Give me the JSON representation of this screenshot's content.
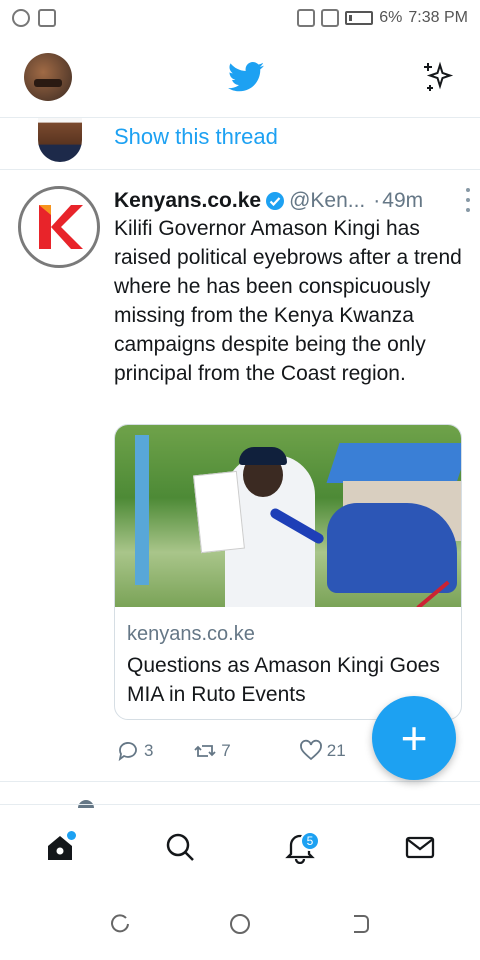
{
  "status_bar": {
    "battery": "6%",
    "time": "7:38 PM"
  },
  "header": {
    "profile_icon": "user-avatar",
    "logo_icon": "twitter-bird-icon",
    "top_tweets_icon": "sparkle-icon"
  },
  "thread": {
    "link_label": "Show this thread"
  },
  "tweet": {
    "author": "Kenyans.co.ke",
    "handle": "@Ken...",
    "separator": "·",
    "time": "49m",
    "text": "Kilifi Governor Amason Kingi has raised political eyebrows after a trend where he has been conspicuously missing from the Kenya Kwanza campaigns despite being the only principal from the Coast region.",
    "card": {
      "domain": "kenyans.co.ke",
      "title": "Questions as Amason Kingi Goes MIA in Ruto Events"
    },
    "actions": {
      "replies": "3",
      "retweets": "7",
      "likes": "21"
    }
  },
  "fab": {
    "label": "+"
  },
  "bottom_nav": {
    "notifications_badge": "5",
    "items": [
      "home-icon",
      "search-icon",
      "notifications-icon",
      "messages-icon"
    ]
  },
  "colors": {
    "accent": "#1da1f2",
    "text": "#14171a",
    "muted": "#657786",
    "divider": "#e6ecf0"
  }
}
